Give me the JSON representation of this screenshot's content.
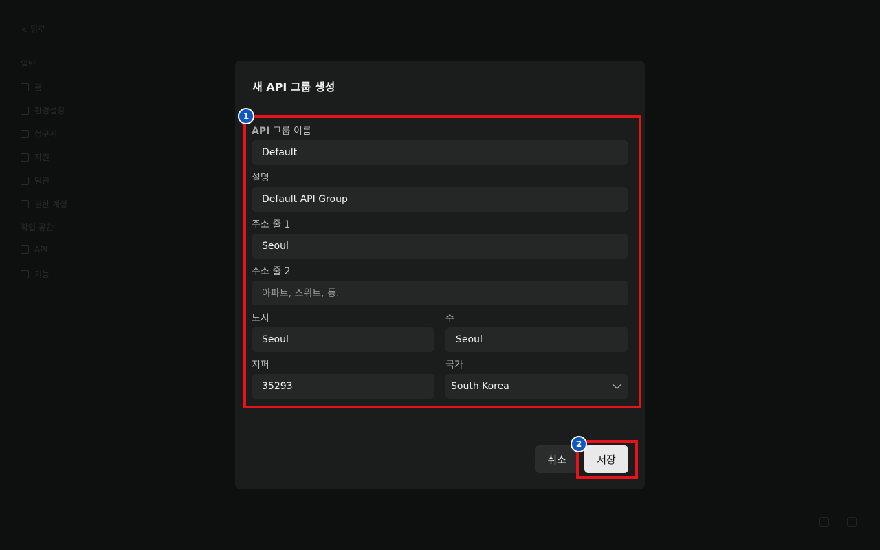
{
  "background": {
    "back_label": "< 뒤로",
    "section_1": "일반",
    "items": [
      "홈",
      "환경설정",
      "청구서",
      "자원",
      "팀원",
      "권한 계정"
    ],
    "section_2": "작업 공간",
    "items_2": [
      "API",
      "기능"
    ]
  },
  "modal": {
    "title": "새 API 그룹 생성",
    "fields": {
      "name": {
        "label_bold": "API",
        "label_rest": " 그룹 이름",
        "value": "Default"
      },
      "description": {
        "label": "설명",
        "value": "Default API Group"
      },
      "address1": {
        "label": "주소 줄 1",
        "value": "Seoul"
      },
      "address2": {
        "label": "주소 줄 2",
        "placeholder": "아파트, 스위트, 등."
      },
      "city": {
        "label": "도시",
        "value": "Seoul"
      },
      "state": {
        "label": "주",
        "value": "Seoul"
      },
      "zip": {
        "label": "지퍼",
        "value": "35293"
      },
      "country": {
        "label": "국가",
        "value": "South Korea"
      }
    },
    "cancel_label": "취소",
    "save_label": "저장"
  },
  "annotations": {
    "badge_1": "1",
    "badge_2": "2",
    "highlight_color": "#e5141a",
    "badge_color": "#0f57c3"
  }
}
